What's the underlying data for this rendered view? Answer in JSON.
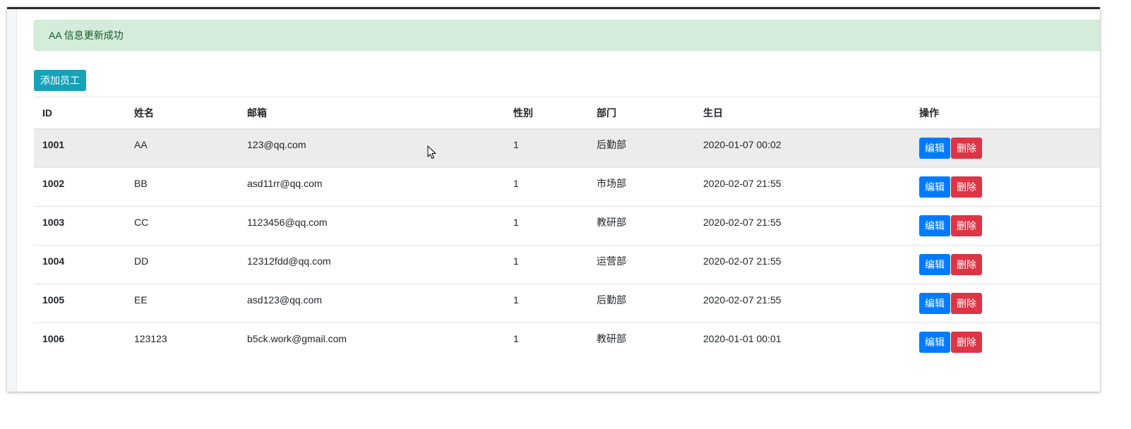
{
  "alert": {
    "message": "AA 信息更新成功"
  },
  "toolbar": {
    "add_label": "添加员工"
  },
  "table": {
    "headers": {
      "id": "ID",
      "name": "姓名",
      "email": "邮箱",
      "gender": "性别",
      "dept": "部门",
      "birth": "生日",
      "action": "操作"
    },
    "rows": [
      {
        "id": "1001",
        "name": "AA",
        "email": "123@qq.com",
        "gender": "1",
        "dept": "后勤部",
        "birth": "2020-01-07 00:02"
      },
      {
        "id": "1002",
        "name": "BB",
        "email": "asd11rr@qq.com",
        "gender": "1",
        "dept": "市场部",
        "birth": "2020-02-07 21:55"
      },
      {
        "id": "1003",
        "name": "CC",
        "email": "1123456@qq.com",
        "gender": "1",
        "dept": "教研部",
        "birth": "2020-02-07 21:55"
      },
      {
        "id": "1004",
        "name": "DD",
        "email": "12312fdd@qq.com",
        "gender": "1",
        "dept": "运营部",
        "birth": "2020-02-07 21:55"
      },
      {
        "id": "1005",
        "name": "EE",
        "email": "asd123@qq.com",
        "gender": "1",
        "dept": "后勤部",
        "birth": "2020-02-07 21:55"
      },
      {
        "id": "1006",
        "name": "123123",
        "email": "b5ck.work@gmail.com",
        "gender": "1",
        "dept": "教研部",
        "birth": "2020-01-01 00:01"
      }
    ],
    "edit_label": "编辑",
    "delete_label": "删除"
  },
  "colors": {
    "alert_bg": "#d4edda",
    "alert_text": "#155724",
    "add_button": "#17a2b8",
    "edit_button": "#007bff",
    "delete_button": "#dc3545"
  },
  "icons": {
    "cursor": "mouse-pointer-icon"
  }
}
